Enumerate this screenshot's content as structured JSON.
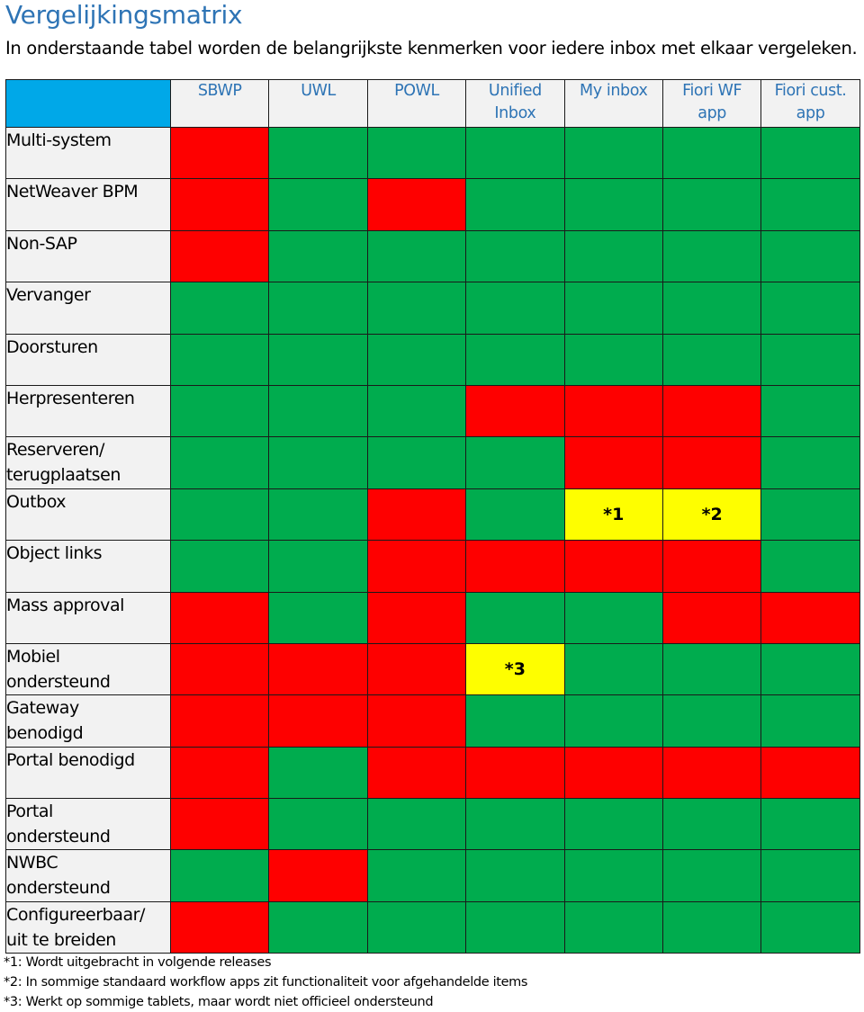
{
  "document": {
    "title": "Vergelijkingsmatrix",
    "intro": "In onderstaande tabel worden de belangrijkste kenmerken voor iedere inbox met elkaar vergeleken."
  },
  "legend_colors": {
    "supported": "#00ac4e",
    "not_supported": "#fe0000",
    "partial": "#fefe00",
    "header_corner": "#00a8e8",
    "header_text": "#2e74b5"
  },
  "columns": [
    {
      "line1": "SBWP",
      "line2": ""
    },
    {
      "line1": "UWL",
      "line2": ""
    },
    {
      "line1": "POWL",
      "line2": ""
    },
    {
      "line1": "Unified",
      "line2": "Inbox"
    },
    {
      "line1": "My inbox",
      "line2": ""
    },
    {
      "line1": "Fiori WF",
      "line2": "app"
    },
    {
      "line1": "Fiori cust.",
      "line2": "app"
    }
  ],
  "rows": [
    {
      "label_line1": "Multi-system",
      "label_line2": "",
      "cells": [
        {
          "status": "r",
          "text": ""
        },
        {
          "status": "g",
          "text": ""
        },
        {
          "status": "g",
          "text": ""
        },
        {
          "status": "g",
          "text": ""
        },
        {
          "status": "g",
          "text": ""
        },
        {
          "status": "g",
          "text": ""
        },
        {
          "status": "g",
          "text": ""
        }
      ]
    },
    {
      "label_line1": "NetWeaver BPM",
      "label_line2": "",
      "cells": [
        {
          "status": "r",
          "text": ""
        },
        {
          "status": "g",
          "text": ""
        },
        {
          "status": "r",
          "text": ""
        },
        {
          "status": "g",
          "text": ""
        },
        {
          "status": "g",
          "text": ""
        },
        {
          "status": "g",
          "text": ""
        },
        {
          "status": "g",
          "text": ""
        }
      ]
    },
    {
      "label_line1": "Non-SAP",
      "label_line2": "",
      "cells": [
        {
          "status": "r",
          "text": ""
        },
        {
          "status": "g",
          "text": ""
        },
        {
          "status": "g",
          "text": ""
        },
        {
          "status": "g",
          "text": ""
        },
        {
          "status": "g",
          "text": ""
        },
        {
          "status": "g",
          "text": ""
        },
        {
          "status": "g",
          "text": ""
        }
      ]
    },
    {
      "label_line1": "Vervanger",
      "label_line2": "",
      "cells": [
        {
          "status": "g",
          "text": ""
        },
        {
          "status": "g",
          "text": ""
        },
        {
          "status": "g",
          "text": ""
        },
        {
          "status": "g",
          "text": ""
        },
        {
          "status": "g",
          "text": ""
        },
        {
          "status": "g",
          "text": ""
        },
        {
          "status": "g",
          "text": ""
        }
      ]
    },
    {
      "label_line1": "Doorsturen",
      "label_line2": "",
      "cells": [
        {
          "status": "g",
          "text": ""
        },
        {
          "status": "g",
          "text": ""
        },
        {
          "status": "g",
          "text": ""
        },
        {
          "status": "g",
          "text": ""
        },
        {
          "status": "g",
          "text": ""
        },
        {
          "status": "g",
          "text": ""
        },
        {
          "status": "g",
          "text": ""
        }
      ]
    },
    {
      "label_line1": "Herpresenteren",
      "label_line2": "",
      "cells": [
        {
          "status": "g",
          "text": ""
        },
        {
          "status": "g",
          "text": ""
        },
        {
          "status": "g",
          "text": ""
        },
        {
          "status": "r",
          "text": ""
        },
        {
          "status": "r",
          "text": ""
        },
        {
          "status": "r",
          "text": ""
        },
        {
          "status": "g",
          "text": ""
        }
      ]
    },
    {
      "label_line1": "Reserveren/",
      "label_line2": "terugplaatsen",
      "cells": [
        {
          "status": "g",
          "text": ""
        },
        {
          "status": "g",
          "text": ""
        },
        {
          "status": "g",
          "text": ""
        },
        {
          "status": "g",
          "text": ""
        },
        {
          "status": "r",
          "text": ""
        },
        {
          "status": "r",
          "text": ""
        },
        {
          "status": "g",
          "text": ""
        }
      ]
    },
    {
      "label_line1": "Outbox",
      "label_line2": "",
      "cells": [
        {
          "status": "g",
          "text": ""
        },
        {
          "status": "g",
          "text": ""
        },
        {
          "status": "r",
          "text": ""
        },
        {
          "status": "g",
          "text": ""
        },
        {
          "status": "y",
          "text": "*1"
        },
        {
          "status": "y",
          "text": "*2"
        },
        {
          "status": "g",
          "text": ""
        }
      ]
    },
    {
      "label_line1": "Object links",
      "label_line2": "",
      "cells": [
        {
          "status": "g",
          "text": ""
        },
        {
          "status": "g",
          "text": ""
        },
        {
          "status": "r",
          "text": ""
        },
        {
          "status": "r",
          "text": ""
        },
        {
          "status": "r",
          "text": ""
        },
        {
          "status": "r",
          "text": ""
        },
        {
          "status": "g",
          "text": ""
        }
      ]
    },
    {
      "label_line1": "Mass approval",
      "label_line2": "",
      "cells": [
        {
          "status": "r",
          "text": ""
        },
        {
          "status": "g",
          "text": ""
        },
        {
          "status": "r",
          "text": ""
        },
        {
          "status": "g",
          "text": ""
        },
        {
          "status": "g",
          "text": ""
        },
        {
          "status": "r",
          "text": ""
        },
        {
          "status": "r",
          "text": ""
        }
      ]
    },
    {
      "label_line1": "Mobiel",
      "label_line2": "ondersteund",
      "cells": [
        {
          "status": "r",
          "text": ""
        },
        {
          "status": "r",
          "text": ""
        },
        {
          "status": "r",
          "text": ""
        },
        {
          "status": "y",
          "text": "*3"
        },
        {
          "status": "g",
          "text": ""
        },
        {
          "status": "g",
          "text": ""
        },
        {
          "status": "g",
          "text": ""
        }
      ]
    },
    {
      "label_line1": "Gateway",
      "label_line2": "benodigd",
      "cells": [
        {
          "status": "r",
          "text": ""
        },
        {
          "status": "r",
          "text": ""
        },
        {
          "status": "r",
          "text": ""
        },
        {
          "status": "g",
          "text": ""
        },
        {
          "status": "g",
          "text": ""
        },
        {
          "status": "g",
          "text": ""
        },
        {
          "status": "g",
          "text": ""
        }
      ]
    },
    {
      "label_line1": "Portal benodigd",
      "label_line2": "",
      "cells": [
        {
          "status": "r",
          "text": ""
        },
        {
          "status": "g",
          "text": ""
        },
        {
          "status": "r",
          "text": ""
        },
        {
          "status": "r",
          "text": ""
        },
        {
          "status": "r",
          "text": ""
        },
        {
          "status": "r",
          "text": ""
        },
        {
          "status": "r",
          "text": ""
        }
      ]
    },
    {
      "label_line1": "Portal",
      "label_line2": "ondersteund",
      "cells": [
        {
          "status": "r",
          "text": ""
        },
        {
          "status": "g",
          "text": ""
        },
        {
          "status": "g",
          "text": ""
        },
        {
          "status": "g",
          "text": ""
        },
        {
          "status": "g",
          "text": ""
        },
        {
          "status": "g",
          "text": ""
        },
        {
          "status": "g",
          "text": ""
        }
      ]
    },
    {
      "label_line1": "NWBC",
      "label_line2": "ondersteund",
      "cells": [
        {
          "status": "g",
          "text": ""
        },
        {
          "status": "r",
          "text": ""
        },
        {
          "status": "g",
          "text": ""
        },
        {
          "status": "g",
          "text": ""
        },
        {
          "status": "g",
          "text": ""
        },
        {
          "status": "g",
          "text": ""
        },
        {
          "status": "g",
          "text": ""
        }
      ]
    },
    {
      "label_line1": "Configureerbaar/",
      "label_line2": "uit te breiden",
      "cells": [
        {
          "status": "r",
          "text": ""
        },
        {
          "status": "g",
          "text": ""
        },
        {
          "status": "g",
          "text": ""
        },
        {
          "status": "g",
          "text": ""
        },
        {
          "status": "g",
          "text": ""
        },
        {
          "status": "g",
          "text": ""
        },
        {
          "status": "g",
          "text": ""
        }
      ]
    }
  ],
  "footnotes": [
    "*1: Wordt uitgebracht in volgende releases",
    "*2: In sommige standaard workflow apps zit functionaliteit voor afgehandelde items",
    "*3: Werkt op sommige tablets, maar wordt niet officieel ondersteund"
  ]
}
